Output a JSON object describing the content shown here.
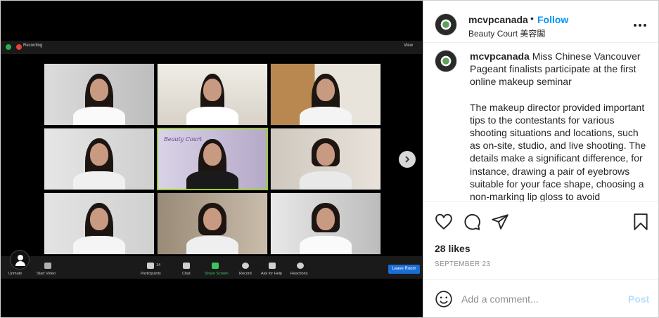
{
  "zoom": {
    "recording_label": "Recording",
    "view_label": "View",
    "toolbar": {
      "unmute": "Unmute",
      "start_video": "Start Video",
      "participants": "Participants",
      "participants_count": "14",
      "chat": "Chat",
      "share_screen": "Share Screen",
      "record": "Record",
      "ask_for_help": "Ask for Help",
      "reactions": "Reactions",
      "leave": "Leave Room"
    },
    "speaker_poster_text": "Beauty Court"
  },
  "post": {
    "username": "mcvpcanada",
    "separator": "•",
    "follow_label": "Follow",
    "location": "Beauty Court 美容閣",
    "caption_username": "mcvpcanada",
    "caption_line1": "Miss Chinese Vancouver Pageant finalists participate at the first online makeup seminar",
    "caption_line2": "The makeup director provided important tips to the contestants for various shooting situations and locations, such as on-site, studio, and live shooting. The details make a significant difference, for instance, drawing a pair of eyebrows suitable for your face shape, choosing a non-marking lip gloss to avoid",
    "likes": "28 likes",
    "date": "SEPTEMBER 23",
    "comment_placeholder": "Add a comment...",
    "post_label": "Post"
  },
  "icons": {
    "more": "more-options-icon",
    "like": "heart-icon",
    "comment": "comment-icon",
    "share": "paper-plane-icon",
    "save": "bookmark-icon",
    "emoji": "emoji-icon",
    "next": "chevron-right-icon"
  },
  "colors": {
    "follow_blue": "#0095f6",
    "post_disabled": "#b2dffc",
    "text": "#262626",
    "muted": "#8e8e8e",
    "zoom_leave": "#1a6dd6",
    "speaker_border": "#9acd32"
  }
}
